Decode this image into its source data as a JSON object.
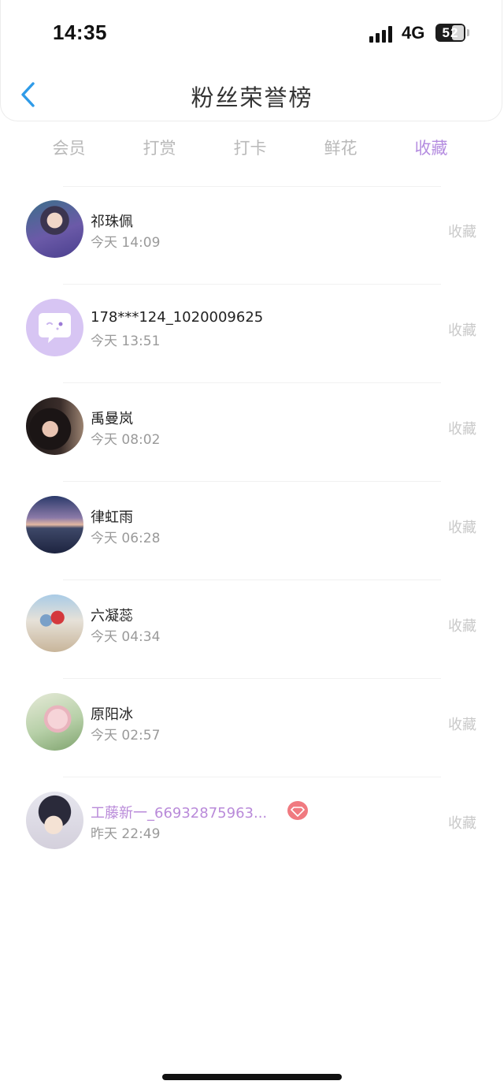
{
  "status_bar": {
    "time": "14:35",
    "network": "4G",
    "battery": "52"
  },
  "header": {
    "back_icon": "chevron-left-icon",
    "title": "粉丝荣誉榜"
  },
  "tabs": [
    {
      "label": "会员",
      "active": false
    },
    {
      "label": "打赏",
      "active": false
    },
    {
      "label": "打卡",
      "active": false
    },
    {
      "label": "鲜花",
      "active": false
    },
    {
      "label": "收藏",
      "active": true
    }
  ],
  "colors": {
    "accent": "#b58de0",
    "back_icon": "#2f9be8",
    "badge": "#f07a80"
  },
  "fans": [
    {
      "name": "祁珠佩",
      "time": "今天 14:09",
      "action": "收藏",
      "vip": false
    },
    {
      "name": "178***124_1020009625",
      "time": "今天 13:51",
      "action": "收藏",
      "vip": false
    },
    {
      "name": "禹曼岚",
      "time": "今天 08:02",
      "action": "收藏",
      "vip": false
    },
    {
      "name": "律虹雨",
      "time": "今天 06:28",
      "action": "收藏",
      "vip": false
    },
    {
      "name": "六凝蕊",
      "time": "今天 04:34",
      "action": "收藏",
      "vip": false
    },
    {
      "name": "原阳冰",
      "time": "今天 02:57",
      "action": "收藏",
      "vip": false
    },
    {
      "name": "工藤新一_66932875963...",
      "time": "昨天 22:49",
      "action": "收藏",
      "vip": true,
      "badge_icon": "diamond-icon"
    }
  ]
}
